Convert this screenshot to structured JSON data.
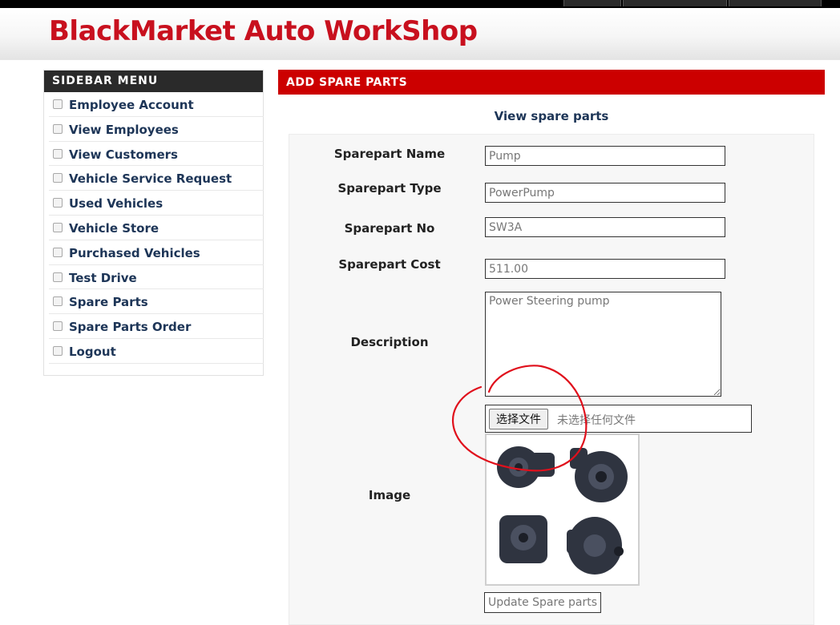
{
  "header": {
    "site_title": "BlackMarket Auto WorkShop"
  },
  "sidebar": {
    "title": "SIDEBAR MENU",
    "items": [
      {
        "label": "Employee Account"
      },
      {
        "label": "View Employees"
      },
      {
        "label": "View Customers"
      },
      {
        "label": "Vehicle Service Request"
      },
      {
        "label": "Used Vehicles"
      },
      {
        "label": "Vehicle Store"
      },
      {
        "label": "Purchased Vehicles"
      },
      {
        "label": "Test Drive"
      },
      {
        "label": "Spare Parts"
      },
      {
        "label": "Spare Parts Order"
      },
      {
        "label": "Logout"
      }
    ]
  },
  "main": {
    "panel_title": "ADD SPARE PARTS",
    "view_link": "View spare parts",
    "form": {
      "name_label": "Sparepart Name",
      "name_value": "Pump",
      "type_label": "Sparepart Type",
      "type_value": "PowerPump",
      "no_label": "Sparepart No",
      "no_value": "SW3A",
      "cost_label": "Sparepart Cost",
      "cost_value": "511.00",
      "description_label": "Description",
      "description_value": "Power Steering pump",
      "image_label": "Image",
      "file_button_label": "选择文件",
      "file_status": "未选择任何文件",
      "submit_label": "Update Spare parts"
    }
  },
  "colors": {
    "brand_red": "#c8101e",
    "panel_red": "#cc0000",
    "nav_text": "#1d3557",
    "annotation": "#e0101c"
  }
}
